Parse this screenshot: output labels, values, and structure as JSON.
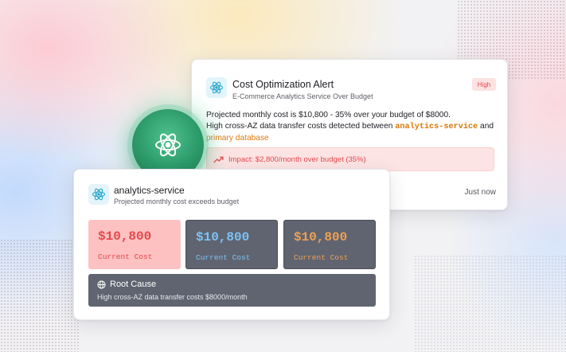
{
  "alert": {
    "title": "Cost Optimization Alert",
    "subtitle": "E-Commerce Analytics Service Over Budget",
    "severity": "High",
    "body_line1": "Projected monthly cost is $10,800 - 35% over your budget of $8000.",
    "body_line2_prefix": "High cross-AZ data transfer costs detected between ",
    "service_code": "analytics-service",
    "body_and": " and ",
    "database": "primary database",
    "impact": "Impact: $2,800/month over budget (35%)",
    "timestamp": "Just now"
  },
  "service": {
    "name": "analytics-service",
    "description": "Projected monthly cost exceeds budget",
    "metrics": [
      {
        "value": "$10,800",
        "label": "Current Cost",
        "color": "#e5484d"
      },
      {
        "value": "$10,800",
        "label": "Current Cost",
        "color": "#7cc4f5"
      },
      {
        "value": "$10,800",
        "label": "Current Cost",
        "color": "#f0a052"
      }
    ],
    "root_cause": {
      "title": "Root Cause",
      "text": "High cross-AZ data transfer costs $8000/month"
    }
  },
  "icons": {
    "app": "atom-icon",
    "impact": "trending-up-icon",
    "root_cause": "globe-icon"
  },
  "colors": {
    "accent_red": "#e5484d",
    "accent_orange": "#d97706",
    "accent_green": "#2c9a69",
    "panel_dark": "#5f6470"
  }
}
